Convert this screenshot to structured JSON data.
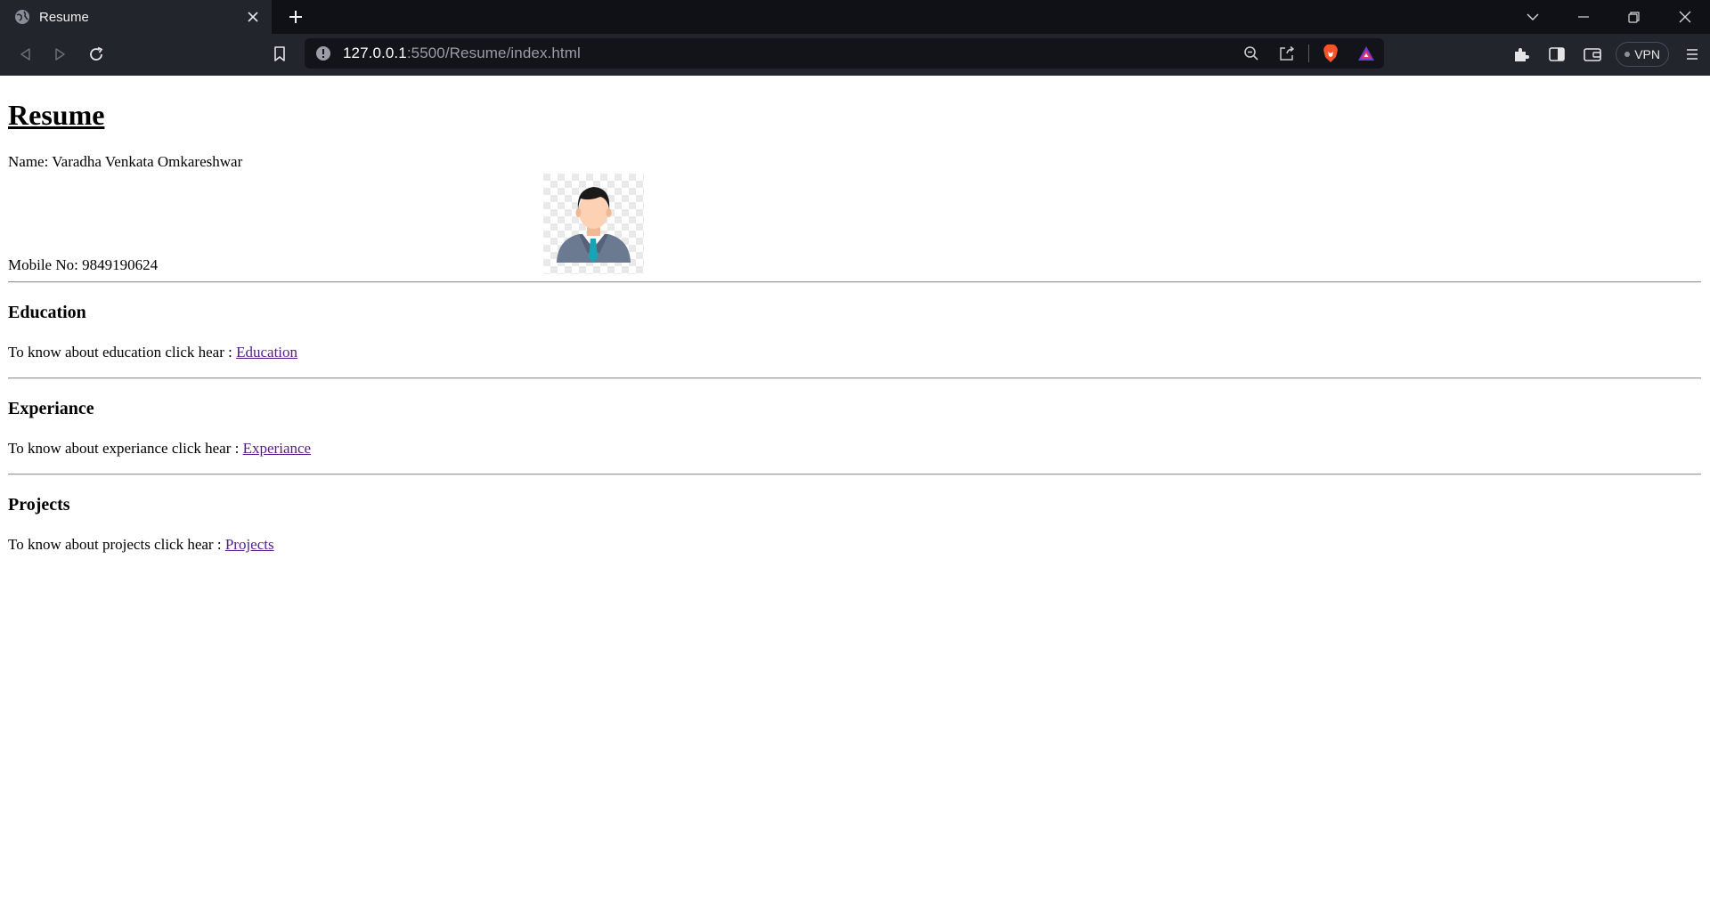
{
  "browser": {
    "tab_title": "Resume",
    "url_host": "127.0.0.1",
    "url_rest": ":5500/Resume/index.html",
    "vpn_label": "VPN"
  },
  "resume": {
    "title": "Resume",
    "name_line": "Name: Varadha Venkata Omkareshwar",
    "mobile_line": "Mobile No: 9849190624",
    "photo_icon": "businessman-avatar-icon"
  },
  "sections": {
    "education": {
      "heading": "Education",
      "text": "To know about education click hear : ",
      "link": "Education"
    },
    "experiance": {
      "heading": "Experiance",
      "text": "To know about experiance click hear : ",
      "link": "Experiance"
    },
    "projects": {
      "heading": "Projects",
      "text": "To know about projects click hear : ",
      "link": "Projects"
    }
  },
  "colors": {
    "chrome_dark": "#0f1117",
    "chrome_toolbar": "#23252d",
    "visited_link": "#551a8b"
  }
}
